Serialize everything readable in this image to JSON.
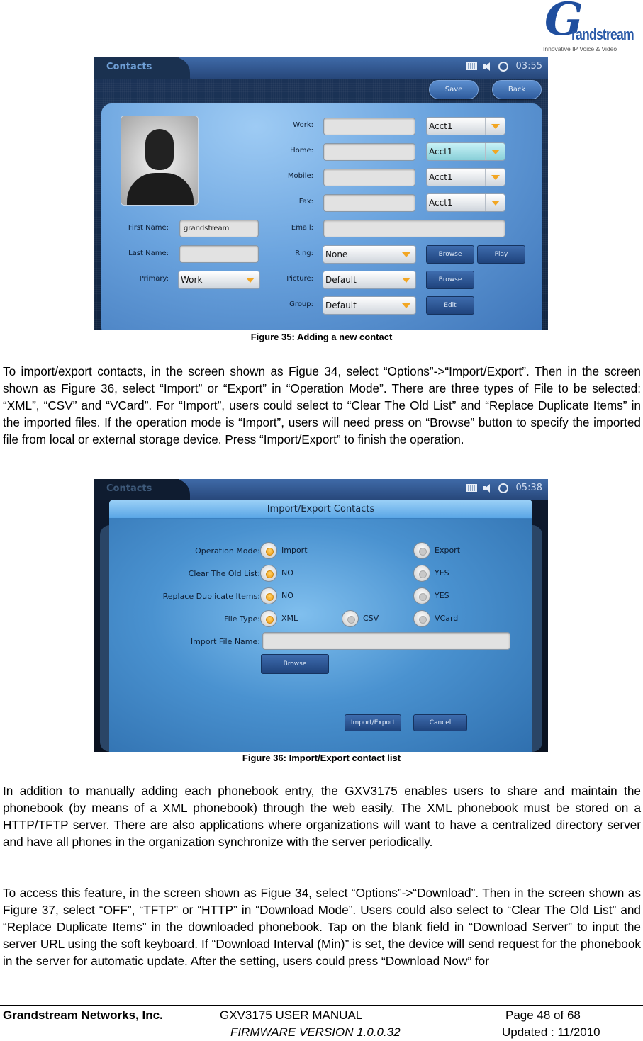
{
  "logo": {
    "letter": "G",
    "wordmark": "randstream",
    "tagline": "Innovative IP Voice & Video"
  },
  "figure35": {
    "screen": {
      "app_title": "Contacts",
      "time": "03:55",
      "status_icons": [
        "keyboard-icon",
        "speaker-icon",
        "sync-icon"
      ],
      "buttons": {
        "save": "Save",
        "back": "Back"
      },
      "phone_fields": [
        {
          "label": "Work:",
          "value": "",
          "account": "Acct1",
          "highlighted": false
        },
        {
          "label": "Home:",
          "value": "",
          "account": "Acct1",
          "highlighted": true
        },
        {
          "label": "Mobile:",
          "value": "",
          "account": "Acct1",
          "highlighted": false
        },
        {
          "label": "Fax:",
          "value": "",
          "account": "Acct1",
          "highlighted": false
        }
      ],
      "email": {
        "label": "Email:",
        "value": ""
      },
      "first_name": {
        "label": "First Name:",
        "value": "grandstream"
      },
      "last_name": {
        "label": "Last Name:",
        "value": ""
      },
      "primary": {
        "label": "Primary:",
        "value": "Work"
      },
      "ring": {
        "label": "Ring:",
        "value": "None",
        "browse": "Browse",
        "play": "Play"
      },
      "picture": {
        "label": "Picture:",
        "value": "Default",
        "browse": "Browse"
      },
      "group": {
        "label": "Group:",
        "value": "Default",
        "edit": "Edit"
      }
    },
    "caption": "Figure 35: Adding a new contact"
  },
  "paragraph1": "To import/export contacts, in the screen shown as Figue 34, select “Options”->“Import/Export”. Then in the screen shown as Figure 36, select “Import” or “Export” in “Operation Mode”. There are three types of File to be selected: “XML”, “CSV” and “VCard”. For “Import”, users could select to “Clear The Old List” and “Replace Duplicate Items” in the imported files. If the operation mode is “Import”, users will need press on “Browse” button to specify the imported file from local or external storage device. Press “Import/Export” to finish the operation.",
  "figure36": {
    "screen": {
      "app_title": "Contacts",
      "time": "05:38",
      "dialog_title": "Import/Export Contacts",
      "rows": [
        {
          "label": "Operation Mode:",
          "options": [
            {
              "text": "Import",
              "selected": true
            },
            {
              "text": "Export",
              "selected": false
            }
          ]
        },
        {
          "label": "Clear The Old List:",
          "options": [
            {
              "text": "NO",
              "selected": true
            },
            {
              "text": "YES",
              "selected": false
            }
          ]
        },
        {
          "label": "Replace Duplicate Items:",
          "options": [
            {
              "text": "NO",
              "selected": true
            },
            {
              "text": "YES",
              "selected": false
            }
          ]
        },
        {
          "label": "File Type:",
          "options": [
            {
              "text": "XML",
              "selected": true
            },
            {
              "text": "CSV",
              "selected": false
            },
            {
              "text": "VCard",
              "selected": false
            }
          ]
        }
      ],
      "import_file_name": {
        "label": "Import File Name:",
        "value": ""
      },
      "browse": "Browse",
      "import_export": "Import/Export",
      "cancel": "Cancel"
    },
    "caption": "Figure 36: Import/Export contact list"
  },
  "paragraph2": "In addition to manually adding each phonebook entry, the GXV3175 enables users to share and maintain the phonebook (by means of a XML phonebook) through the web easily. The XML phonebook must be stored on a HTTP/TFTP server. There are also applications where organizations will want to have a centralized directory server and have all phones in the organization synchronize with the server periodically.",
  "paragraph3": "To access this feature, in the screen shown as Figue 34, select “Options”->“Download”. Then in the screen shown as Figure 37, select “OFF”, “TFTP” or “HTTP” in “Download Mode”. Users could also select to “Clear The Old List” and “Replace Duplicate Items” in the downloaded phonebook. Tap on the blank field in “Download Server” to input the server URL using the soft keyboard. If “Download Interval (Min)” is set, the device will send request for the phonebook in the server for automatic update. After the setting, users could press “Download Now” for",
  "footer": {
    "company": "Grandstream Networks, Inc.",
    "manual": "GXV3175 USER MANUAL",
    "firmware": "FIRMWARE VERSION 1.0.0.32",
    "page": "Page 48 of 68",
    "updated": "Updated : 11/2010"
  }
}
